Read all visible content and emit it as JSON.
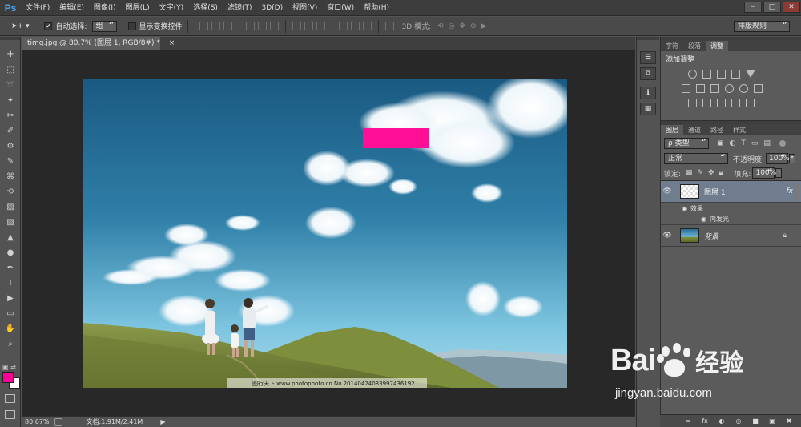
{
  "app": {
    "logo": "Ps"
  },
  "menu": [
    "文件(F)",
    "编辑(E)",
    "图像(I)",
    "图层(L)",
    "文字(Y)",
    "选择(S)",
    "滤镜(T)",
    "3D(D)",
    "视图(V)",
    "窗口(W)",
    "帮助(H)"
  ],
  "window_controls": [
    "−",
    "□",
    "✕"
  ],
  "options_bar": {
    "auto_select_label": "自动选择:",
    "auto_select_checked": true,
    "auto_select_value": "组",
    "show_transform_label": "显示变换控件",
    "mode_3d_label": "3D 模式:",
    "workspace": "排版规则"
  },
  "document": {
    "tab_title": "timg.jpg @ 80.7% (图层 1, RGB/8#) *",
    "close_glyph": "×",
    "zoom": "80.67%",
    "doc_info": "文档:1.91M/2.41M",
    "watermark": "图行天下 www.photophoto.cn  No.20140424033997436192"
  },
  "colors": {
    "foreground": "#ff0096",
    "background": "#ffffff",
    "accent_rect": "#ff0f96",
    "sky_top": "#1d5f86",
    "sky_bottom": "#8fd0e6"
  },
  "panels": {
    "top_tabs": [
      "字符",
      "段落",
      "调整"
    ],
    "active_top_tab": "调整",
    "adjust_title": "添加调整",
    "layer_tabs": [
      "图层",
      "通道",
      "路径",
      "样式"
    ],
    "active_layer_tab": "图层",
    "filter_kind": "ρ 类型",
    "blend_mode": "正常",
    "opacity_label": "不透明度:",
    "opacity_value": "100%",
    "lock_label": "锁定:",
    "fill_label": "填充:",
    "fill_value": "100%",
    "layers": [
      {
        "name": "图层 1",
        "fx": "fx",
        "selected": true
      },
      {
        "name": "背景",
        "fx": "",
        "selected": false
      }
    ],
    "effects_label": "效果",
    "effect_item": "内发光"
  },
  "tools": [
    "move-tool",
    "marquee-tool",
    "lasso-tool",
    "quick-select-tool",
    "crop-tool",
    "eyedropper-tool",
    "healing-tool",
    "brush-tool",
    "stamp-tool",
    "history-brush-tool",
    "eraser-tool",
    "gradient-tool",
    "blur-tool",
    "dodge-tool",
    "pen-tool",
    "type-tool",
    "path-select-tool",
    "shape-tool",
    "hand-tool",
    "zoom-tool"
  ],
  "tool_glyphs": [
    "✚",
    "⬚",
    "➰",
    "✦",
    "✂",
    "✐",
    "⚙",
    "✎",
    "⌘",
    "⟲",
    "▨",
    "▧",
    "▲",
    "●",
    "✒",
    "T",
    "▶",
    "▭",
    "✋",
    "⌕"
  ],
  "mid_icons": [
    "☰",
    "⧉",
    "ℹ",
    "▦"
  ],
  "layer_bottom_icons": [
    "∞",
    "fx",
    "◐",
    "◎",
    "■",
    "▣",
    "✖"
  ],
  "baidu": {
    "brand": "Bai",
    "brand2": "经验",
    "url": "jingyan.baidu.com"
  }
}
